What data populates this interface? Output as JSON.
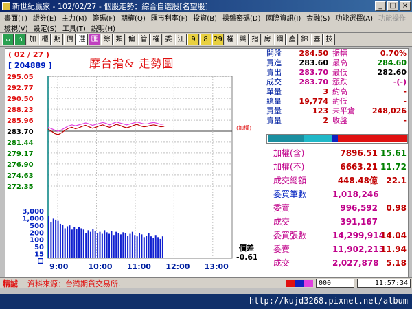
{
  "window": {
    "title": "新世紀贏家 - 102/02/27 - 個股走勢：綜合自選股[名望股]",
    "minimize": "_",
    "maximize": "□",
    "close": "×"
  },
  "menu": {
    "row1": [
      "畫面(T)",
      "證券(E)",
      "主力(M)",
      "籌碼(F)",
      "期權(Q)",
      "匯市利率(F)",
      "投資(B)",
      "操盤密碼(D)",
      "國際資訊(I)",
      "金融(S)",
      "功能選擇(A)",
      "功能操作"
    ],
    "row2": [
      "檢視(V)",
      "設定(S)",
      "工具(T)",
      "說明(H)"
    ]
  },
  "toolbar": {
    "buttons": [
      "ᴗ",
      "⌂",
      "加",
      "櫃",
      "期",
      "價",
      "選",
      "匯",
      "綜",
      "類",
      "偏",
      "管",
      "權",
      "委",
      "江",
      "9",
      "8",
      "29",
      "權",
      "興",
      "指",
      "房",
      "鋼",
      "產",
      "錦",
      "塞",
      "技"
    ]
  },
  "chart": {
    "title": "摩台指&  走勢圖",
    "date_label": "( 02 / 27 )",
    "code_label": "[ 204889 ]",
    "ref_label": "(加權)",
    "spread_label": "價差",
    "spread_value": "-0.61"
  },
  "chart_data": {
    "type": "line",
    "price_axis": {
      "ticks": [
        "295.05",
        "292.77",
        "290.50",
        "288.23",
        "285.96",
        "283.70",
        "281.44",
        "279.17",
        "276.90",
        "274.63",
        "272.35"
      ],
      "ylim": [
        272.35,
        295.05
      ],
      "reference": 283.7
    },
    "volume_axis": {
      "ticks": [
        "3,000",
        "1,000",
        "500",
        "200",
        "100",
        "50",
        "15",
        "口"
      ],
      "scale": "log"
    },
    "x_ticks": [
      "9:00",
      "10:00",
      "11:00",
      "12:00",
      "13:00"
    ],
    "xlim_minutes": [
      0,
      285
    ],
    "series": [
      {
        "name": "",
        "color": "#c00000",
        "values": [
          284.1,
          283.7,
          283.2,
          283.0,
          283.4,
          283.9,
          284.3,
          284.5,
          284.2,
          284.4,
          284.7,
          284.9,
          284.6,
          284.3,
          284.5,
          284.8,
          285.0,
          284.7,
          284.5,
          284.8,
          285.1,
          284.9,
          284.6,
          284.4,
          284.6,
          284.9,
          285.1,
          284.8,
          284.6,
          284.7,
          284.9,
          285.0,
          284.8,
          284.6,
          284.7
        ]
      },
      {
        "name": "",
        "color": "#e040e0",
        "values": [
          284.5,
          284.2,
          283.9,
          283.7,
          284.0,
          284.4,
          284.8,
          285.0,
          284.8,
          285.0,
          285.2,
          285.4,
          285.2,
          284.9,
          285.1,
          285.3,
          285.5,
          285.3,
          285.0,
          285.3,
          285.6,
          285.4,
          285.2,
          285.0,
          285.2,
          285.4,
          285.6,
          285.4,
          285.2,
          285.2,
          285.4,
          285.5,
          285.3,
          285.1,
          285.2
        ]
      }
    ],
    "volume": [
      1200,
      600,
      900,
      800,
      700,
      500,
      450,
      300,
      380,
      420,
      260,
      340,
      280,
      350,
      300,
      260,
      180,
      240,
      200,
      280,
      220,
      180,
      200,
      160,
      240,
      190,
      160,
      220,
      140,
      200,
      180,
      150,
      190,
      170,
      130,
      160,
      200,
      140,
      120,
      180,
      150,
      110,
      130,
      170,
      120,
      100,
      140,
      110,
      90,
      120
    ],
    "grid": true,
    "legend": "none"
  },
  "quote": {
    "rows": [
      {
        "l1": "開盤",
        "v1": "284.50",
        "c1": "red",
        "l2": "振幅",
        "v2": "0.70%",
        "c2": "red"
      },
      {
        "l1": "買進",
        "v1": "283.60",
        "c1": "black",
        "l2": "最高",
        "v2": "284.60",
        "c2": "green"
      },
      {
        "l1": "賣出",
        "v1": "283.70",
        "c1": "mag",
        "l2": "最低",
        "v2": "282.60",
        "c2": "black"
      },
      {
        "l1": "成交",
        "v1": "283.70",
        "c1": "mag",
        "l2": "漲跌",
        "v2": "-(-)",
        "c2": "mag"
      },
      {
        "l1": "單量",
        "v1": "3",
        "c1": "red",
        "l2": "約高",
        "v2": "-",
        "c2": "red"
      },
      {
        "l1": "總量",
        "v1": "19,774",
        "c1": "red",
        "l2": "約低",
        "v2": "-",
        "c2": "red"
      },
      {
        "l1": "買量",
        "v1": "123",
        "c1": "red",
        "l2": "未平倉",
        "v2": "248,026",
        "c2": "red"
      },
      {
        "l1": "賣量",
        "v1": "2",
        "c1": "red",
        "l2": "收盤",
        "v2": "-",
        "c2": "red"
      }
    ]
  },
  "stats": {
    "rows": [
      {
        "label": "加權(含)",
        "lc": "mag",
        "value": "7896.51",
        "vc": "red",
        "pct": "15.61",
        "pc": "green"
      },
      {
        "label": "加權(不)",
        "lc": "mag",
        "value": "6663.21",
        "vc": "red",
        "pct": "11.72",
        "pc": "green"
      },
      {
        "label": "成交總額",
        "lc": "mag",
        "value": "448.48億",
        "vc": "red",
        "pct": "22.1",
        "pc": "red"
      },
      {
        "label": "委買筆數",
        "lc": "blu",
        "value": "1,018,246",
        "vc": "mag",
        "pct": "",
        "pc": "red"
      },
      {
        "label": "委賣",
        "lc": "mag",
        "value": "996,592",
        "vc": "mag",
        "pct": "0.98",
        "pc": "red"
      },
      {
        "label": "成交",
        "lc": "mag",
        "value": "391,167",
        "vc": "mag",
        "pct": "",
        "pc": "red"
      },
      {
        "label": "委買張數",
        "lc": "mag",
        "value": "14,299,914",
        "vc": "mag",
        "pct": "14.04",
        "pc": "red"
      },
      {
        "label": "委賣",
        "lc": "mag",
        "value": "11,902,213",
        "vc": "mag",
        "pct": "11.94",
        "pc": "red"
      },
      {
        "label": "成交",
        "lc": "mag",
        "value": "2,027,878",
        "vc": "mag",
        "pct": "5.18",
        "pc": "red"
      }
    ]
  },
  "status": {
    "left": "精誠",
    "message": "資料來源：台灣期貨交易所.",
    "box": "000",
    "time": "11:57:34"
  },
  "watermark": "http://kujd3268.pixnet.net/album"
}
